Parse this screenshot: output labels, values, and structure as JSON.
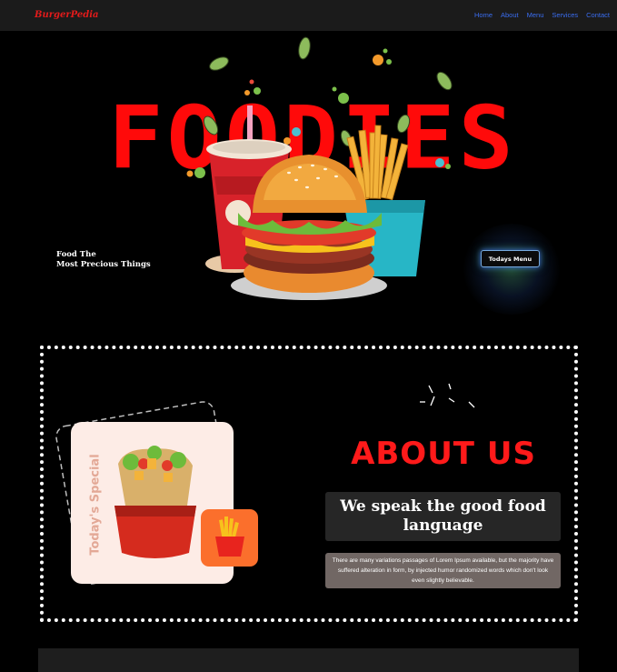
{
  "nav": {
    "brand": "BurgerPedia",
    "links": [
      "Home",
      "About",
      "Menu",
      "Services",
      "Contact"
    ]
  },
  "hero": {
    "title": "FOODIES",
    "tagline_line1": "Food The",
    "tagline_line2": "Most Precious Things",
    "button": "Todays Menu"
  },
  "about": {
    "special_label": "Today's Special",
    "title": "ABOUT US",
    "subtitle": "We speak the good food language",
    "body": "There are many variations passages of Lorem Ipsum available, but the majority have suffered alteration in form, by injected humor randomized words which don't look even slightly believable."
  },
  "colors": {
    "accent_red": "#ff0a0a",
    "nav_link_blue": "#3a6df0",
    "card_peach": "#fdece6",
    "fries_orange": "#fb6f2c",
    "body_box": "#716764"
  },
  "icons": [
    "burger-icon",
    "soda-cup-icon",
    "fries-box-icon",
    "leaf-icon",
    "wrap-icon",
    "fries-icon"
  ]
}
